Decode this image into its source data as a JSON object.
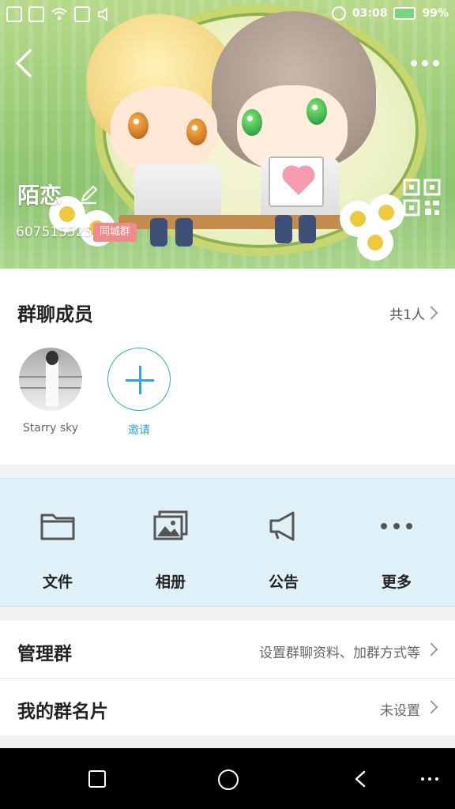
{
  "status_bar": {
    "time": "03:08",
    "battery_percent": "99%",
    "icons": [
      "sim1-icon",
      "sim2-icon",
      "wifi-icon",
      "image-icon",
      "mute-icon",
      "alarm-icon",
      "battery-icon"
    ]
  },
  "header": {
    "group_name": "陌恋",
    "group_id": "607515525",
    "tag": "同城群",
    "icons": [
      "back-icon",
      "more-icon",
      "edit-icon",
      "qr-code-icon"
    ]
  },
  "members": {
    "title": "群聊成员",
    "count": "共1人",
    "items": [
      {
        "name": "Starry sky",
        "avatar": "photo"
      }
    ],
    "invite_label": "邀请"
  },
  "tools": [
    {
      "label": "文件",
      "icon": "folder-icon"
    },
    {
      "label": "相册",
      "icon": "album-icon"
    },
    {
      "label": "公告",
      "icon": "megaphone-icon"
    },
    {
      "label": "更多",
      "icon": "more-dots-icon"
    }
  ],
  "rows": [
    {
      "title": "管理群",
      "value": "设置群聊资料、加群方式等"
    },
    {
      "title": "我的群名片",
      "value": "未设置"
    }
  ],
  "nav": {
    "icons": [
      "recent-apps-icon",
      "home-icon",
      "back-nav-icon",
      "menu-icon"
    ]
  },
  "colors": {
    "accent": "#2ea6e0",
    "tools_bg": "#dff0f8",
    "tag_bg": "#f18a8a"
  }
}
